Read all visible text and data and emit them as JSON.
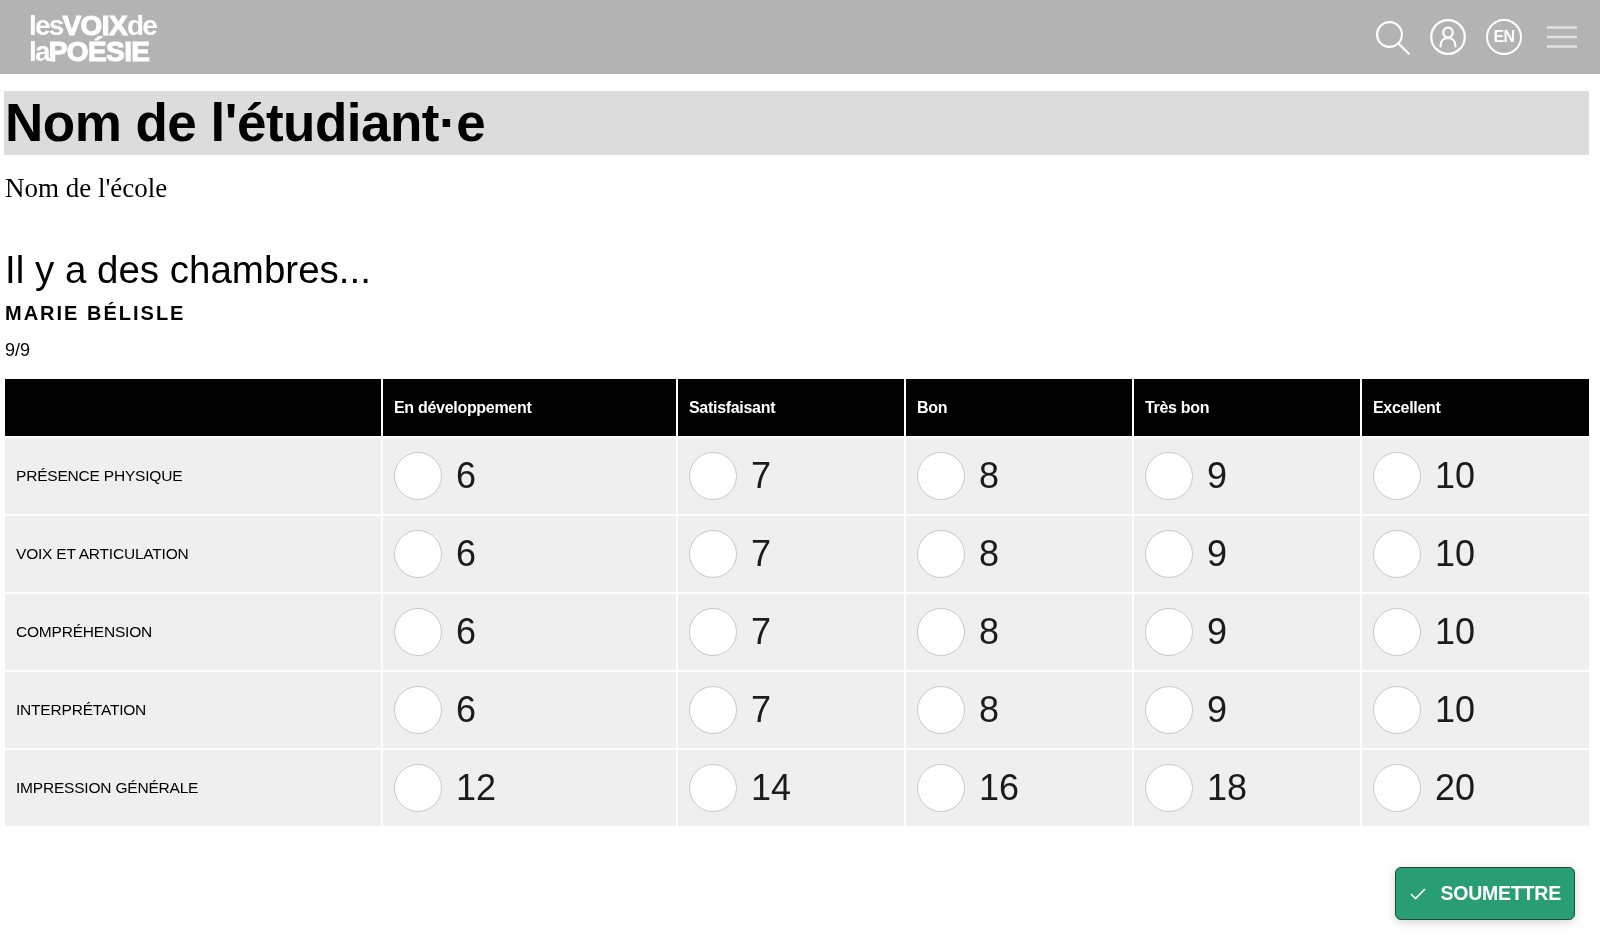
{
  "header": {
    "logo": {
      "lines": [
        [
          {
            "text": "les",
            "strong": false
          },
          {
            "text": "VOIX",
            "strong": true
          },
          {
            "text": "de",
            "strong": false
          }
        ],
        [
          {
            "text": "la",
            "strong": false
          },
          {
            "text": "POÉSIE",
            "strong": true
          }
        ]
      ]
    },
    "language_button": "EN"
  },
  "student_name": "Nom de l'étudiant·e",
  "school_name": "Nom de l'école",
  "poem": {
    "title": "Il y a des chambres...",
    "author": "MARIE BÉLISLE",
    "counter": "9/9"
  },
  "rubric": {
    "columns": [
      "En développement",
      "Satisfaisant",
      "Bon",
      "Très bon",
      "Excellent"
    ],
    "rows": [
      {
        "criterion": "PRÉSENCE PHYSIQUE",
        "options": [
          {
            "points": "6",
            "selected": false
          },
          {
            "points": "7",
            "selected": false
          },
          {
            "points": "8",
            "selected": false
          },
          {
            "points": "9",
            "selected": false
          },
          {
            "points": "10",
            "selected": false
          }
        ]
      },
      {
        "criterion": "VOIX ET ARTICULATION",
        "options": [
          {
            "points": "6",
            "selected": false
          },
          {
            "points": "7",
            "selected": false
          },
          {
            "points": "8",
            "selected": false
          },
          {
            "points": "9",
            "selected": false
          },
          {
            "points": "10",
            "selected": false
          }
        ]
      },
      {
        "criterion": "COMPRÉHENSION",
        "options": [
          {
            "points": "6",
            "selected": false
          },
          {
            "points": "7",
            "selected": false
          },
          {
            "points": "8",
            "selected": false
          },
          {
            "points": "9",
            "selected": false
          },
          {
            "points": "10",
            "selected": false
          }
        ]
      },
      {
        "criterion": "INTERPRÉTATION",
        "options": [
          {
            "points": "6",
            "selected": false
          },
          {
            "points": "7",
            "selected": false
          },
          {
            "points": "8",
            "selected": false
          },
          {
            "points": "9",
            "selected": false
          },
          {
            "points": "10",
            "selected": false
          }
        ]
      },
      {
        "criterion": "IMPRESSION GÉNÉRALE",
        "options": [
          {
            "points": "12",
            "selected": false
          },
          {
            "points": "14",
            "selected": false
          },
          {
            "points": "16",
            "selected": false
          },
          {
            "points": "18",
            "selected": false
          },
          {
            "points": "20",
            "selected": false
          }
        ]
      }
    ]
  },
  "submit_button": {
    "label": "SOUMETTRE"
  }
}
